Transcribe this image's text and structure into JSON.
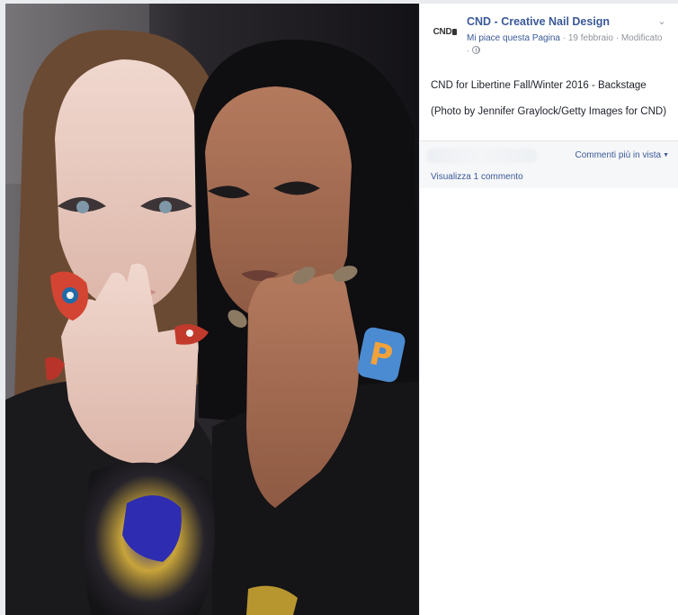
{
  "post": {
    "page_name": "CND - Creative Nail Design",
    "logo_text": "CND",
    "like_page": "Mi piace questa Pagina",
    "separator": "·",
    "date": "19 febbraio",
    "edited": "Modificato",
    "text_line1": "CND for Libertine Fall/Winter 2016 - Backstage",
    "text_line2": "(Photo by Jennifer Graylock/Getty Images for CND)"
  },
  "comments": {
    "sort_label": "Commenti più in vista",
    "view_label": "Visualizza 1 commento"
  },
  "photo": {
    "patch_letter": "P"
  },
  "icons": {
    "chevron": "chevron-down-icon",
    "globe": "globe-icon",
    "caret": "caret-down-icon"
  },
  "colors": {
    "link": "#3b5998",
    "meta": "#90949c",
    "comments_bg": "#f6f7f9"
  }
}
